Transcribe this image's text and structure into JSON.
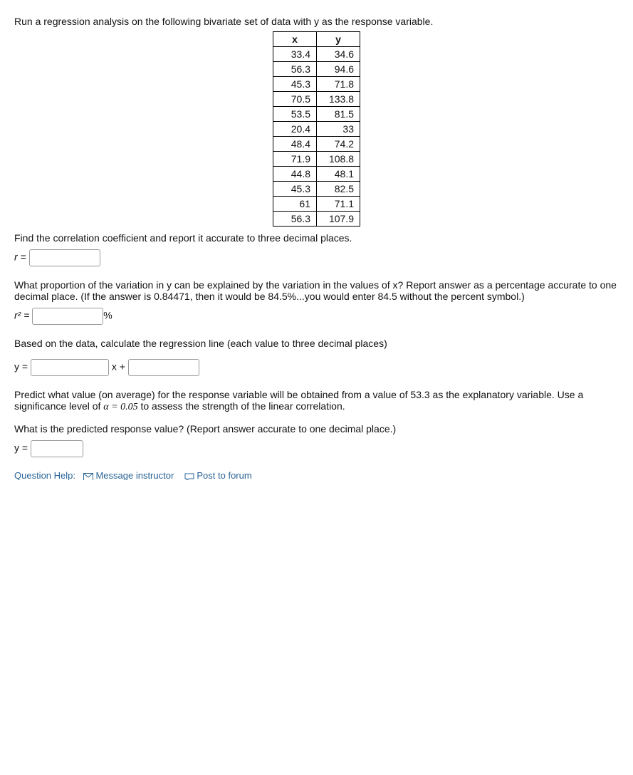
{
  "intro": "Run a regression analysis on the following bivariate set of data with y as the response variable.",
  "chart_data": {
    "type": "table",
    "columns": [
      "x",
      "y"
    ],
    "rows": [
      {
        "x": "33.4",
        "y": "34.6"
      },
      {
        "x": "56.3",
        "y": "94.6"
      },
      {
        "x": "45.3",
        "y": "71.8"
      },
      {
        "x": "70.5",
        "y": "133.8"
      },
      {
        "x": "53.5",
        "y": "81.5"
      },
      {
        "x": "20.4",
        "y": "33"
      },
      {
        "x": "48.4",
        "y": "74.2"
      },
      {
        "x": "71.9",
        "y": "108.8"
      },
      {
        "x": "44.8",
        "y": "48.1"
      },
      {
        "x": "45.3",
        "y": "82.5"
      },
      {
        "x": "61",
        "y": "71.1"
      },
      {
        "x": "56.3",
        "y": "107.9"
      }
    ]
  },
  "q_corr": "Find the correlation coefficient and report it accurate to three decimal places.",
  "label_r": "r =",
  "q_r2_a": "What proportion of the variation in y can be explained by the variation in the values of x? Report answer as a percentage accurate to one decimal place.  (If the answer is 0.84471, then it would be 84.5%...you would enter 84.5 without the percent symbol.)",
  "label_r2": "r² =",
  "percent": "%",
  "q_regline": "Based on the data, calculate the regression line (each value to three decimal places)",
  "label_y": "y =",
  "label_xplus": "x +",
  "q_predict_a": "Predict what value (on average) for the response variable will be obtained from a value of 53.3 as the explanatory variable. Use a significance level of ",
  "alpha_eq": "α = 0.05",
  "q_predict_b": " to assess the strength of the linear correlation.",
  "q_predval": "What is the predicted response value?  (Report answer accurate to one decimal place.)",
  "label_y2": "y =",
  "footer": {
    "qh": "Question Help:",
    "msg": "Message instructor",
    "post": "Post to forum"
  }
}
